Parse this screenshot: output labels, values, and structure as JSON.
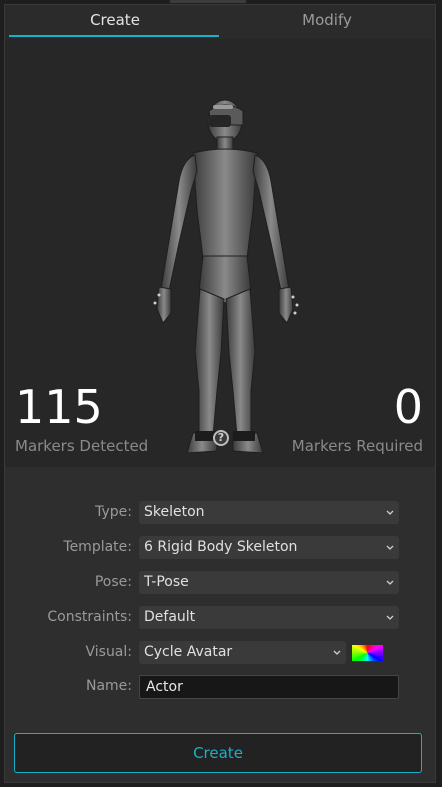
{
  "tabs": [
    {
      "label": "Create",
      "active": true
    },
    {
      "label": "Modify",
      "active": false
    }
  ],
  "viewport": {
    "markers_detected_value": "115",
    "markers_detected_label": "Markers Detected",
    "markers_required_value": "0",
    "markers_required_label": "Markers Required",
    "help_icon_text": "?"
  },
  "form": {
    "type": {
      "label": "Type:",
      "value": "Skeleton"
    },
    "template": {
      "label": "Template:",
      "value": "6 Rigid Body Skeleton"
    },
    "pose": {
      "label": "Pose:",
      "value": "T-Pose"
    },
    "constraints": {
      "label": "Constraints:",
      "value": "Default"
    },
    "visual": {
      "label": "Visual:",
      "value": "Cycle Avatar"
    },
    "name": {
      "label": "Name:",
      "value": "Actor"
    }
  },
  "create_button_label": "Create",
  "colors": {
    "accent": "#1ab0c8",
    "panel_bg": "#2e2e2e",
    "viewport_bg": "#272727"
  },
  "icons": [
    "help-icon",
    "chevron-down-icon",
    "color-swatch-icon",
    "avatar-figure"
  ]
}
